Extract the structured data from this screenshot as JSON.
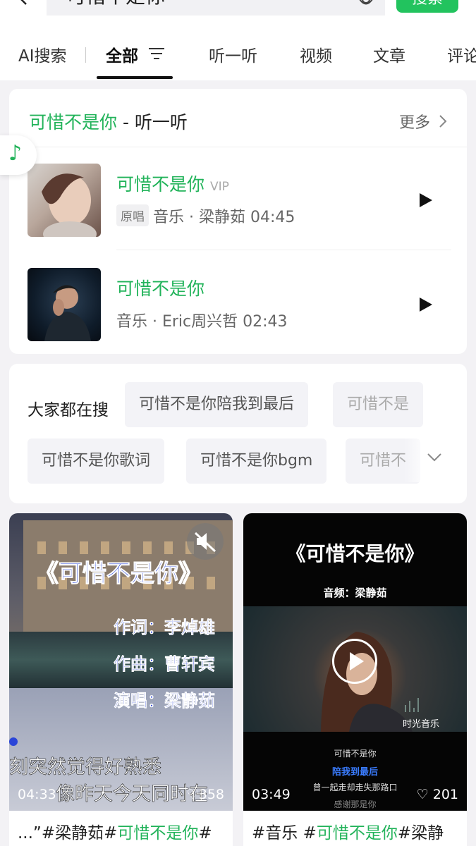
{
  "search": {
    "query": "可惜不是你",
    "button_label": "搜索"
  },
  "tabs": [
    {
      "label": "AI搜索"
    },
    {
      "label": "全部"
    },
    {
      "label": "听一听"
    },
    {
      "label": "视频"
    },
    {
      "label": "文章"
    },
    {
      "label": "评论"
    }
  ],
  "music_section": {
    "title_keyword": "可惜不是你",
    "title_suffix": " - 听一听",
    "more_label": "更多",
    "songs": [
      {
        "title": "可惜不是你",
        "vip": "VIP",
        "badge": "原唱",
        "meta": "音乐 · 梁静茹 04:45"
      },
      {
        "title": "可惜不是你",
        "meta": "音乐 · Eric周兴哲 02:43"
      }
    ]
  },
  "trending": {
    "label": "大家都在搜",
    "chips": [
      "可惜不是你陪我到最后",
      "可惜不是",
      "可惜不是你歌词",
      "可惜不是你bgm",
      "可惜不"
    ]
  },
  "videos": [
    {
      "duration": "04:33",
      "likes": "358",
      "caption_prefix": "...”#梁静茹#",
      "caption_keyword": "可惜不是你",
      "caption_suffix": "#",
      "overlay_title": "《可惜不是你》",
      "credits": [
        "作词：李焯雄",
        "作曲：曹轩宾",
        "演唱：梁静茹"
      ],
      "lyrics": [
        "刻突然觉得好熟悉",
        "像昨天今天同时在"
      ]
    },
    {
      "duration": "03:49",
      "likes": "201",
      "caption_prefix": "#音乐 #",
      "caption_keyword": "可惜不是你",
      "caption_suffix": "#梁静",
      "overlay_title": "《可惜不是你》",
      "overlay_sub": "音频：梁静茹",
      "brand": "时光音乐",
      "lyrics": [
        "可惜不是你",
        "陪我到最后",
        "曾一起走却走失那路口",
        "感谢那是你"
      ]
    }
  ],
  "colors": {
    "accent_green": "#22b35a",
    "lyric_blue": "#2a45d8"
  }
}
